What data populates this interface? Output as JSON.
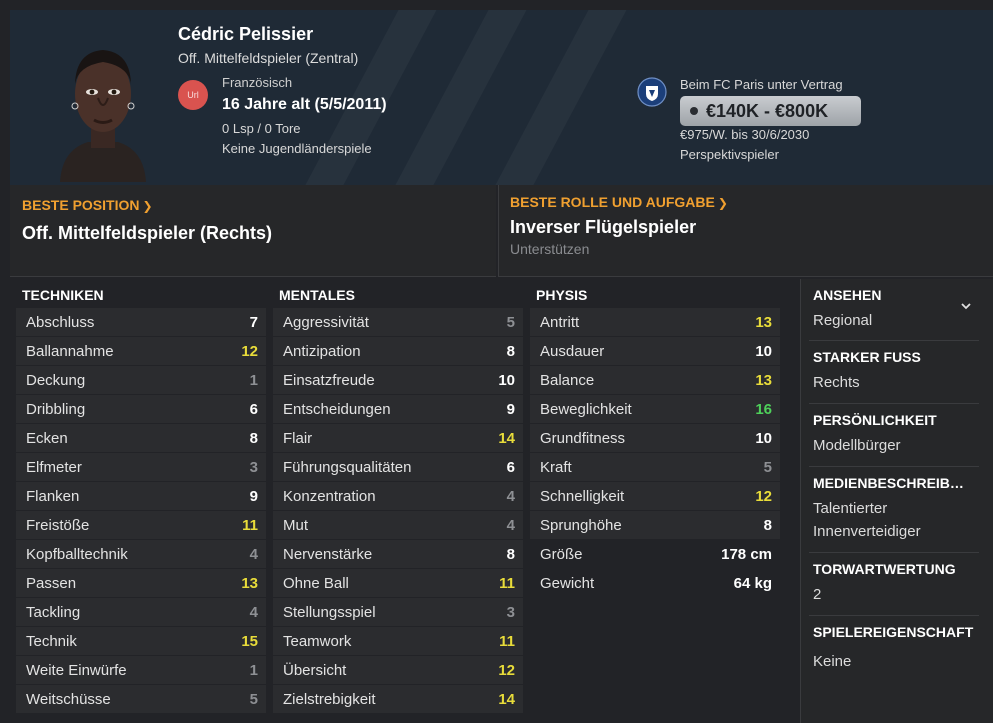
{
  "player": {
    "name": "Cédric Pelissier",
    "position": "Off. Mittelfeldspieler (Zentral)",
    "flag_code": "Url",
    "nationality": "Französisch",
    "age": "16 Jahre alt",
    "dob": "(5/5/2011)",
    "caps": "0 Lsp / 0 Tore",
    "youth_caps": "Keine Jugendländerspiele"
  },
  "contract": {
    "club_line": "Beim FC Paris unter Vertrag",
    "value": "€140K - €800K",
    "wage": "€975/W. bis 30/6/2030",
    "status": "Perspektivspieler"
  },
  "best_position": {
    "label": "BESTE POSITION",
    "value": "Off. Mittelfeldspieler (Rechts)"
  },
  "best_role": {
    "label": "BESTE ROLLE UND AUFGABE",
    "value": "Inverser Flügelspieler",
    "duty": "Unterstützen"
  },
  "technical": {
    "title": "TECHNIKEN",
    "items": [
      {
        "name": "Abschluss",
        "value": "7",
        "color": "white"
      },
      {
        "name": "Ballannahme",
        "value": "12",
        "color": "yellow"
      },
      {
        "name": "Deckung",
        "value": "1",
        "color": "gray"
      },
      {
        "name": "Dribbling",
        "value": "6",
        "color": "white"
      },
      {
        "name": "Ecken",
        "value": "8",
        "color": "white"
      },
      {
        "name": "Elfmeter",
        "value": "3",
        "color": "gray"
      },
      {
        "name": "Flanken",
        "value": "9",
        "color": "white"
      },
      {
        "name": "Freistöße",
        "value": "11",
        "color": "yellow"
      },
      {
        "name": "Kopfballtechnik",
        "value": "4",
        "color": "gray"
      },
      {
        "name": "Passen",
        "value": "13",
        "color": "yellow"
      },
      {
        "name": "Tackling",
        "value": "4",
        "color": "gray"
      },
      {
        "name": "Technik",
        "value": "15",
        "color": "yellow"
      },
      {
        "name": "Weite Einwürfe",
        "value": "1",
        "color": "gray"
      },
      {
        "name": "Weitschüsse",
        "value": "5",
        "color": "gray"
      }
    ]
  },
  "mental": {
    "title": "MENTALES",
    "items": [
      {
        "name": "Aggressivität",
        "value": "5",
        "color": "gray"
      },
      {
        "name": "Antizipation",
        "value": "8",
        "color": "white"
      },
      {
        "name": "Einsatzfreude",
        "value": "10",
        "color": "white"
      },
      {
        "name": "Entscheidungen",
        "value": "9",
        "color": "white"
      },
      {
        "name": "Flair",
        "value": "14",
        "color": "yellow"
      },
      {
        "name": "Führungsqualitäten",
        "value": "6",
        "color": "white"
      },
      {
        "name": "Konzentration",
        "value": "4",
        "color": "gray"
      },
      {
        "name": "Mut",
        "value": "4",
        "color": "gray"
      },
      {
        "name": "Nervenstärke",
        "value": "8",
        "color": "white"
      },
      {
        "name": "Ohne Ball",
        "value": "11",
        "color": "yellow"
      },
      {
        "name": "Stellungsspiel",
        "value": "3",
        "color": "gray"
      },
      {
        "name": "Teamwork",
        "value": "11",
        "color": "yellow"
      },
      {
        "name": "Übersicht",
        "value": "12",
        "color": "yellow"
      },
      {
        "name": "Zielstrebigkeit",
        "value": "14",
        "color": "yellow"
      }
    ]
  },
  "physical": {
    "title": "PHYSIS",
    "items": [
      {
        "name": "Antritt",
        "value": "13",
        "color": "yellow"
      },
      {
        "name": "Ausdauer",
        "value": "10",
        "color": "white"
      },
      {
        "name": "Balance",
        "value": "13",
        "color": "yellow"
      },
      {
        "name": "Beweglichkeit",
        "value": "16",
        "color": "green"
      },
      {
        "name": "Grundfitness",
        "value": "10",
        "color": "white"
      },
      {
        "name": "Kraft",
        "value": "5",
        "color": "gray"
      },
      {
        "name": "Schnelligkeit",
        "value": "12",
        "color": "yellow"
      },
      {
        "name": "Sprunghöhe",
        "value": "8",
        "color": "white"
      }
    ],
    "extra": [
      {
        "name": "Größe",
        "value": "178 cm"
      },
      {
        "name": "Gewicht",
        "value": "64 kg"
      }
    ]
  },
  "side": {
    "reputation_title": "ANSEHEN",
    "reputation_value": "Regional",
    "foot_title": "STARKER FUSS",
    "foot_value": "Rechts",
    "personality_title": "PERSÖNLICHKEIT",
    "personality_value": "Modellbürger",
    "media_title": "MEDIENBESCHREIB…",
    "media_value_1": "Talentierter",
    "media_value_2": "Innenverteidiger",
    "gk_title": "TORWARTWERTUNG",
    "gk_value": "2",
    "traits_title": "SPIELEREIGENSCHAFT",
    "traits_value": "Keine"
  },
  "colors": {
    "accent": "#f0a030",
    "yellow": "#e8dc3a",
    "green": "#4ed05a",
    "gray": "#8e9094"
  }
}
